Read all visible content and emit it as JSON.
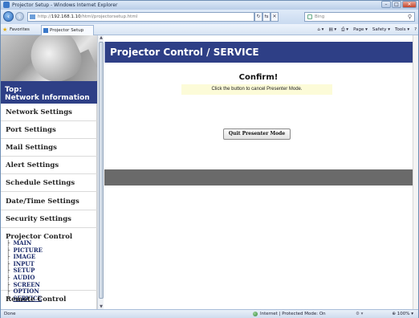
{
  "window": {
    "title": "Projector Setup - Windows Internet Explorer",
    "minimize": "–",
    "maximize": "□",
    "close": "✕"
  },
  "address_bar": {
    "url_prefix": "http://",
    "url_host": "192.168.1.10",
    "url_path": "/html/projectorsetup.html",
    "search_placeholder": "Bing",
    "refresh": "↻",
    "go": "⇆",
    "stop": "✕"
  },
  "favorites_bar": {
    "favorites_label": "Favorites",
    "tab_label": "Projector Setup",
    "commands": [
      "Page ▾",
      "Safety ▾",
      "Tools ▾"
    ]
  },
  "sidebar": {
    "top_label_1": "Top:",
    "top_label_2": "Network Information",
    "items": [
      "Network Settings",
      "Port Settings",
      "Mail Settings",
      "Alert Settings",
      "Schedule Settings",
      "Date/Time Settings",
      "Security Settings"
    ],
    "projector_control": {
      "label": "Projector Control",
      "sub_items": [
        "MAIN",
        "PICTURE",
        "IMAGE",
        "INPUT",
        "SETUP",
        "AUDIO",
        "SCREEN",
        "OPTION",
        "SERVICE"
      ],
      "active": "SERVICE"
    },
    "remote_control": "Remote Control"
  },
  "main": {
    "header": "Projector Control / SERVICE",
    "confirm_title": "Confirm!",
    "confirm_message": "Click the button to cancel Presenter Mode.",
    "quit_button": "Quit Presenter Mode"
  },
  "status_bar": {
    "status": "Done",
    "zone": "Internet | Protected Mode: On",
    "zoom": "100%"
  }
}
